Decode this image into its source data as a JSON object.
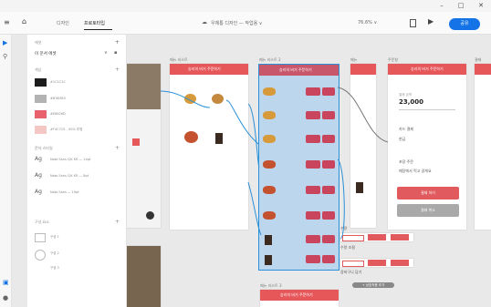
{
  "window": {
    "controls": [
      "–",
      "□",
      "✕"
    ]
  },
  "toolbar": {
    "tabs": [
      "디자인",
      "프로토타입"
    ],
    "doc_title": "우체통 디자인 — 작업용 ∨",
    "zoom": "76.6% ∨",
    "share_label": "공유"
  },
  "assets_panel": {
    "section_label": "에셋",
    "doc_label": "이 문서 에셋",
    "colors_label": "색상",
    "colors": [
      {
        "hex": "#1c1c1c",
        "label": "#1C1C1C"
      },
      {
        "hex": "#b3b3b3",
        "label": "#B3B3B3"
      },
      {
        "hex": "#e8626d",
        "label": "#E8626D"
      },
      {
        "hex": "#f4c7c5",
        "label": "#F4C7C5 - 50% 투명"
      }
    ],
    "char_styles_label": "문자 스타일",
    "char_styles": [
      {
        "sample": "Ag",
        "label": "Noto Sans CJK KR — 14pt"
      },
      {
        "sample": "Ag",
        "label": "Noto Sans CJK KR — 8pt"
      },
      {
        "sample": "Ag",
        "label": "Noto Sans — 10pt"
      }
    ],
    "components_label": "구성 요소",
    "components": [
      "구성 1",
      "구성 2",
      "구성 3"
    ]
  },
  "canvas": {
    "artboard_labels": [
      "메뉴 리스트",
      "메뉴 리스트 2",
      "메뉴",
      "주문창",
      "결제"
    ],
    "menu_header": "승리의 버거 주문하기",
    "order_amount": "23,000",
    "order_amount_caption": "결제 금액",
    "pay_options": [
      "카드 결제",
      "현금"
    ],
    "extra_options": [
      "포장 주문",
      "매장에서 먹고 갈게요"
    ],
    "pay_button": "결제 하기",
    "cancel_button": "결제 취소",
    "counter_label": "수량",
    "counter_caption": "주문 가능 메뉴",
    "side_labels": [
      "수량 조절",
      "장바구니 담기"
    ],
    "bottom_pill": "+ 상호작용 추가",
    "bottom_artboard_label": "메뉴 리스트 3",
    "bottom_artboard_title": "승리의 버거 주문하기"
  },
  "colors": {
    "brand": "#e6575a",
    "accent": "#1473e6",
    "wire": "#2a90d8",
    "selection": "#bcd6ee"
  }
}
